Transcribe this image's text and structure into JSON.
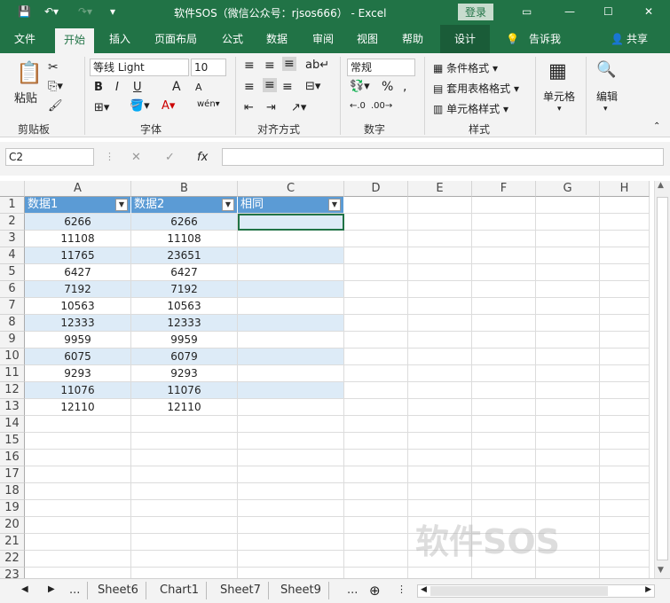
{
  "titlebar": {
    "title": "软件SOS（微信公众号：rjsos666） -  Excel",
    "login": "登录",
    "quick_access": [
      "save-icon",
      "undo-icon",
      "redo-icon",
      "customize-icon"
    ]
  },
  "tabs": [
    "文件",
    "开始",
    "插入",
    "页面布局",
    "公式",
    "数据",
    "审阅",
    "视图",
    "帮助",
    "设计",
    "告诉我",
    "共享"
  ],
  "ribbon": {
    "clipboard": {
      "paste": "粘贴",
      "label": "剪贴板"
    },
    "font": {
      "name": "等线 Light",
      "size": "10",
      "label": "字体",
      "bold": "B",
      "italic": "I",
      "underline": "U",
      "grow": "A",
      "shrink": "A"
    },
    "alignment": {
      "label": "对齐方式"
    },
    "number": {
      "format": "常规",
      "label": "数字",
      "percent": "%"
    },
    "styles": {
      "cond": "条件格式",
      "table": "套用表格格式",
      "cell": "单元格样式",
      "label": "样式"
    },
    "cells": {
      "label": "单元格"
    },
    "editing": {
      "label": "编辑"
    }
  },
  "formula_bar": {
    "name_box": "C2",
    "fx": "fx",
    "value": ""
  },
  "grid": {
    "columns": [
      "A",
      "B",
      "C",
      "D",
      "E",
      "F",
      "G",
      "H"
    ],
    "rows": [
      "1",
      "2",
      "3",
      "4",
      "5",
      "6",
      "7",
      "8",
      "9",
      "10",
      "11",
      "12",
      "13",
      "14",
      "15",
      "16",
      "17",
      "18",
      "19",
      "20",
      "21",
      "22",
      "23"
    ],
    "headers": [
      "数据1",
      "数据2",
      "相同"
    ],
    "data": [
      [
        "6266",
        "6266"
      ],
      [
        "11108",
        "11108"
      ],
      [
        "11765",
        "23651"
      ],
      [
        "6427",
        "6427"
      ],
      [
        "7192",
        "7192"
      ],
      [
        "10563",
        "10563"
      ],
      [
        "12333",
        "12333"
      ],
      [
        "9959",
        "9959"
      ],
      [
        "6075",
        "6079"
      ],
      [
        "9293",
        "9293"
      ],
      [
        "11076",
        "11076"
      ],
      [
        "12110",
        "12110"
      ]
    ],
    "band_color": "#ddebf7",
    "header_color": "#5b9bd5"
  },
  "sheets": [
    "...",
    "Sheet6",
    "Chart1",
    "Sheet7",
    "Sheet9",
    "..."
  ],
  "watermark": "软件SOS",
  "colors": {
    "brand": "#217346"
  }
}
